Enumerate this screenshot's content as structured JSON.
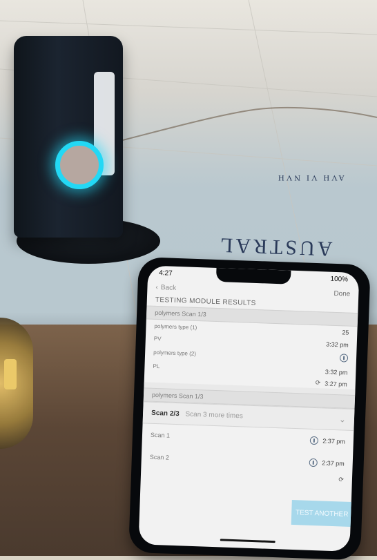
{
  "map": {
    "label_main": "AUSTRAL",
    "label_coast": "AVH VI NVH"
  },
  "phone": {
    "status": {
      "left": "4:27",
      "right": "100%"
    },
    "nav": {
      "back": "Back",
      "right": "Done"
    },
    "title": "TESTING MODULE RESULTS",
    "section_top": "polymers Scan 1/3",
    "results": [
      {
        "label": "polymers type (1)",
        "value": "25"
      },
      {
        "label": "PV",
        "value": "3:32 pm"
      },
      {
        "label": "polymers type (2)",
        "value": ""
      },
      {
        "label": "PL",
        "value": "3:32 pm"
      }
    ],
    "sync_time": "3:27 pm",
    "section_bottom": "polymers Scan 1/3",
    "scan_header": {
      "primary": "Scan 2/3",
      "secondary": "Scan 3 more times"
    },
    "scan_rows": [
      {
        "label": "Scan 1",
        "time": "2:37 pm"
      },
      {
        "label": "Scan 2",
        "time": "2:37 pm"
      }
    ],
    "action_button": "TEST ANOTHER",
    "colors": {
      "accent": "#a7d8eb",
      "device_ring": "#23d8f5"
    },
    "icons": {
      "back": "chevron-left-icon",
      "chevron_down": "chevron-down-icon",
      "info": "info-icon",
      "sync": "sync-icon"
    }
  }
}
